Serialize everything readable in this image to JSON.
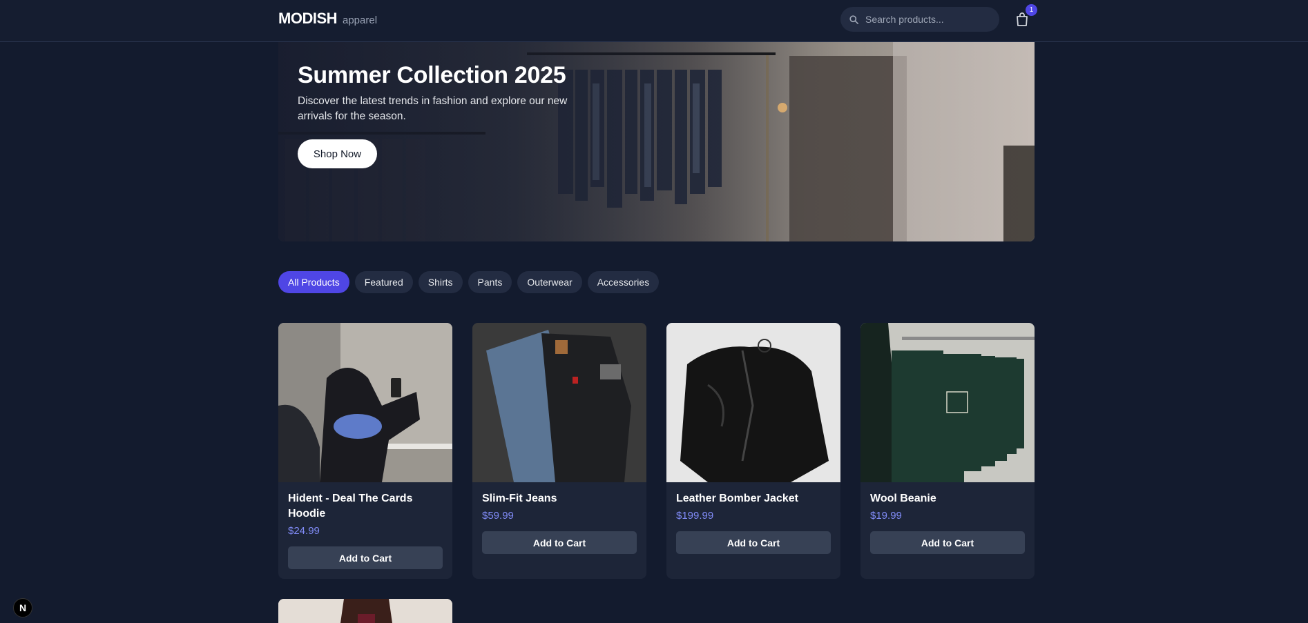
{
  "header": {
    "brand_name": "MODISH",
    "brand_sub": "apparel",
    "search_placeholder": "Search products...",
    "cart_count": "1"
  },
  "hero": {
    "title": "Summer Collection 2025",
    "description": "Discover the latest trends in fashion and explore our new arrivals for the season.",
    "cta": "Shop Now"
  },
  "categories": [
    {
      "label": "All Products",
      "active": true
    },
    {
      "label": "Featured",
      "active": false
    },
    {
      "label": "Shirts",
      "active": false
    },
    {
      "label": "Pants",
      "active": false
    },
    {
      "label": "Outerwear",
      "active": false
    },
    {
      "label": "Accessories",
      "active": false
    }
  ],
  "products": [
    {
      "name": "Hident - Deal The Cards Hoodie",
      "price": "$24.99",
      "button": "Add to Cart"
    },
    {
      "name": "Slim-Fit Jeans",
      "price": "$59.99",
      "button": "Add to Cart"
    },
    {
      "name": "Leather Bomber Jacket",
      "price": "$199.99",
      "button": "Add to Cart"
    },
    {
      "name": "Wool Beanie",
      "price": "$19.99",
      "button": "Add to Cart"
    }
  ],
  "devtools_badge": "N",
  "colors": {
    "accent": "#4f46e5",
    "price": "#818cf8",
    "background": "#131b2e",
    "card": "#1d2538"
  }
}
